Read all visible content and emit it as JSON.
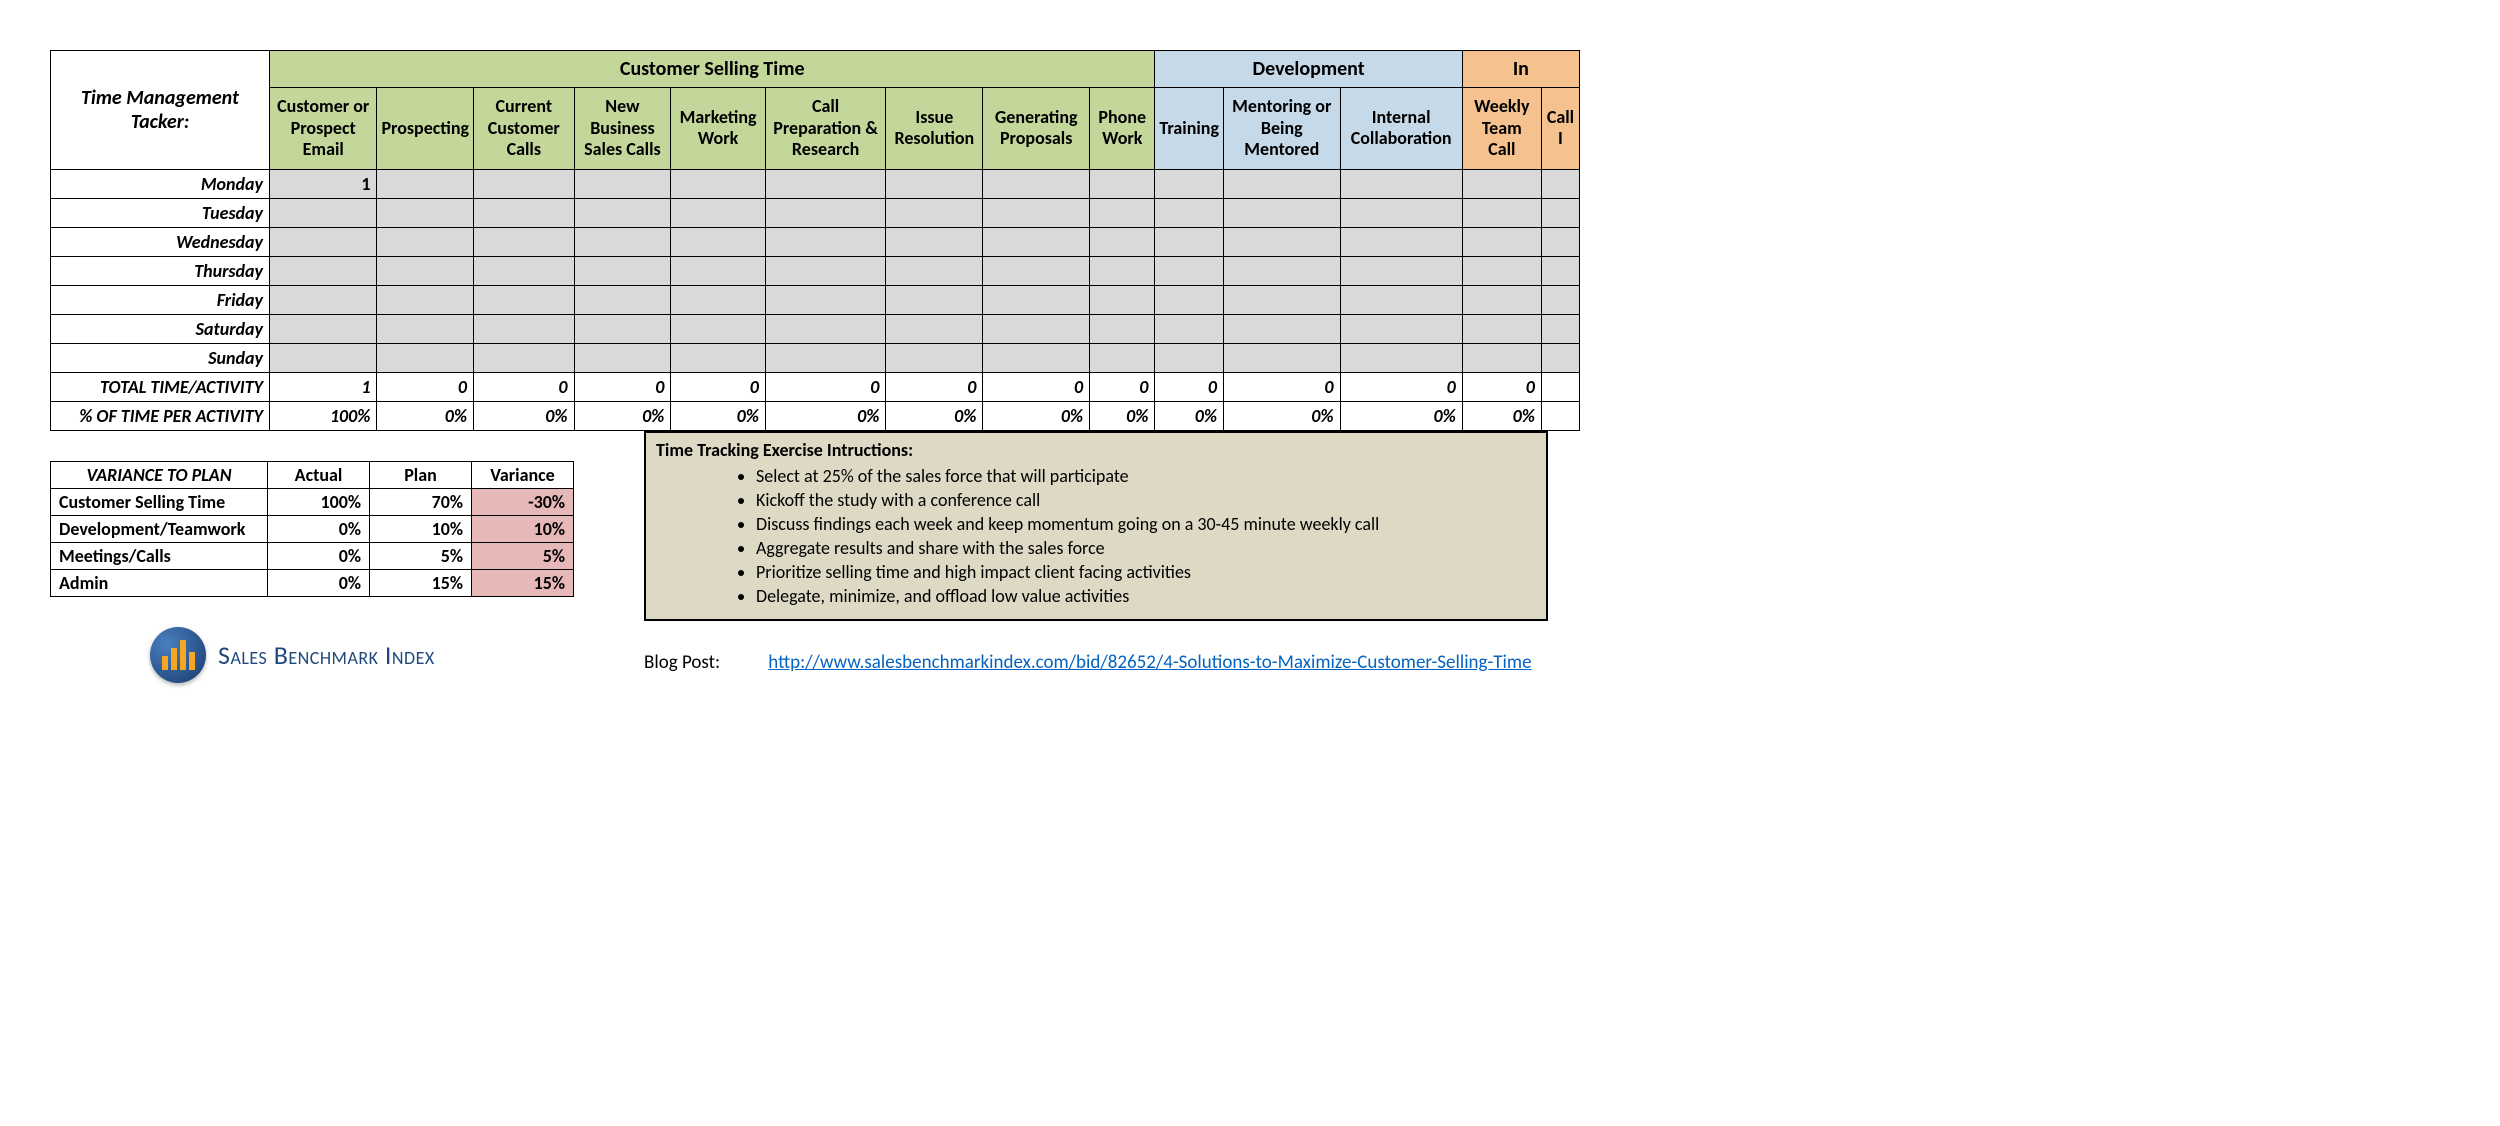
{
  "tracker": {
    "title": "Time Management Tacker:",
    "groups": [
      {
        "label": "Customer Selling Time",
        "span": 9,
        "class": "group-green"
      },
      {
        "label": "Development",
        "span": 3,
        "class": "group-blue"
      },
      {
        "label": "In",
        "span": 2,
        "class": "group-orange"
      }
    ],
    "columns": [
      {
        "label": "Customer or Prospect Email",
        "class": "group-green"
      },
      {
        "label": "Prospecting",
        "class": "group-green"
      },
      {
        "label": "Current Customer Calls",
        "class": "group-green"
      },
      {
        "label": "New Business Sales Calls",
        "class": "group-green"
      },
      {
        "label": "Marketing Work",
        "class": "group-green"
      },
      {
        "label": "Call Preparation & Research",
        "class": "group-green"
      },
      {
        "label": "Issue Resolution",
        "class": "group-green"
      },
      {
        "label": "Generating Proposals",
        "class": "group-green"
      },
      {
        "label": "Phone Work",
        "class": "group-green"
      },
      {
        "label": "Training",
        "class": "group-blue"
      },
      {
        "label": "Mentoring or Being Mentored",
        "class": "group-blue"
      },
      {
        "label": "Internal Collaboration",
        "class": "group-blue"
      },
      {
        "label": "Weekly Team Call",
        "class": "group-orange"
      },
      {
        "label": "Call I",
        "class": "group-orange"
      }
    ],
    "days": [
      {
        "name": "Monday",
        "values": [
          "1",
          "",
          "",
          "",
          "",
          "",
          "",
          "",
          "",
          "",
          "",
          "",
          "",
          ""
        ]
      },
      {
        "name": "Tuesday",
        "values": [
          "",
          "",
          "",
          "",
          "",
          "",
          "",
          "",
          "",
          "",
          "",
          "",
          "",
          ""
        ]
      },
      {
        "name": "Wednesday",
        "values": [
          "",
          "",
          "",
          "",
          "",
          "",
          "",
          "",
          "",
          "",
          "",
          "",
          "",
          ""
        ]
      },
      {
        "name": "Thursday",
        "values": [
          "",
          "",
          "",
          "",
          "",
          "",
          "",
          "",
          "",
          "",
          "",
          "",
          "",
          ""
        ]
      },
      {
        "name": "Friday",
        "values": [
          "",
          "",
          "",
          "",
          "",
          "",
          "",
          "",
          "",
          "",
          "",
          "",
          "",
          ""
        ]
      },
      {
        "name": "Saturday",
        "values": [
          "",
          "",
          "",
          "",
          "",
          "",
          "",
          "",
          "",
          "",
          "",
          "",
          "",
          ""
        ]
      },
      {
        "name": "Sunday",
        "values": [
          "",
          "",
          "",
          "",
          "",
          "",
          "",
          "",
          "",
          "",
          "",
          "",
          "",
          ""
        ]
      }
    ],
    "total_label": "TOTAL TIME/ACTIVITY",
    "totals": [
      "1",
      "0",
      "0",
      "0",
      "0",
      "0",
      "0",
      "0",
      "0",
      "0",
      "0",
      "0",
      "0",
      ""
    ],
    "pct_label": "% OF TIME PER ACTIVITY",
    "pcts": [
      "100%",
      "0%",
      "0%",
      "0%",
      "0%",
      "0%",
      "0%",
      "0%",
      "0%",
      "0%",
      "0%",
      "0%",
      "0%",
      ""
    ]
  },
  "variance": {
    "title": "VARIANCE TO PLAN",
    "headers": [
      "Actual",
      "Plan",
      "Variance"
    ],
    "rows": [
      {
        "cat": "Customer Selling Time",
        "actual": "100%",
        "plan": "70%",
        "variance": "-30%"
      },
      {
        "cat": "Development/Teamwork",
        "actual": "0%",
        "plan": "10%",
        "variance": "10%"
      },
      {
        "cat": "Meetings/Calls",
        "actual": "0%",
        "plan": "5%",
        "variance": "5%"
      },
      {
        "cat": "Admin",
        "actual": "0%",
        "plan": "15%",
        "variance": "15%"
      }
    ]
  },
  "instructions": {
    "title": "Time Tracking Exercise Intructions:",
    "items": [
      "Select at 25% of the sales force that will participate",
      "Kickoff the study with a conference call",
      "Discuss findings each week and keep momentum going on a 30-45 minute weekly call",
      "Aggregate results and share with the sales force",
      "Prioritize selling time and high impact client facing activities",
      "Delegate, minimize, and offload low value activities"
    ]
  },
  "logo": {
    "text": "Sales Benchmark Index"
  },
  "blog": {
    "label": "Blog Post:",
    "url": "http://www.salesbenchmarkindex.com/bid/82652/4-Solutions-to-Maximize-Customer-Selling-Time"
  }
}
